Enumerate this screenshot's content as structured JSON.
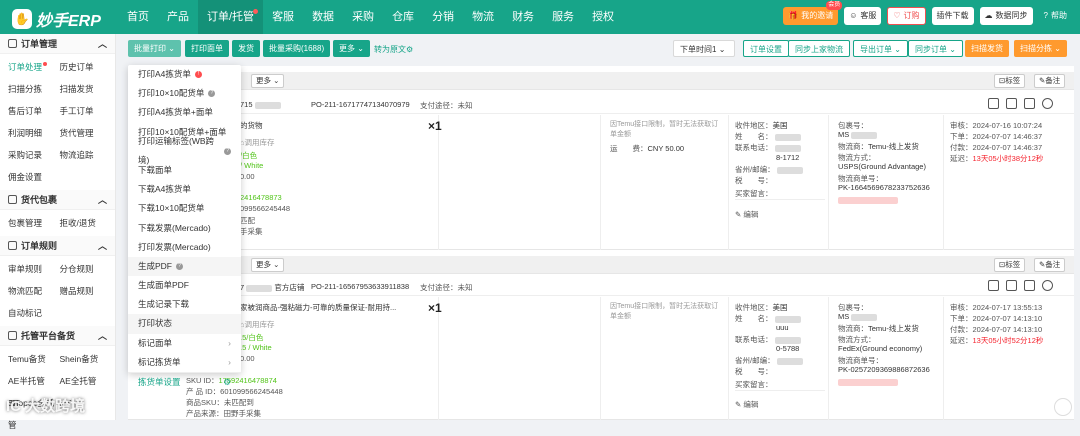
{
  "app": {
    "logo": "妙手ERP"
  },
  "nav": [
    {
      "label": "首页"
    },
    {
      "label": "产品"
    },
    {
      "label": "订单/托管"
    },
    {
      "label": "客服"
    },
    {
      "label": "数据"
    },
    {
      "label": "采购"
    },
    {
      "label": "仓库"
    },
    {
      "label": "分销"
    },
    {
      "label": "物流"
    },
    {
      "label": "财务"
    },
    {
      "label": "服务"
    },
    {
      "label": "授权"
    }
  ],
  "header": {
    "invite": "我的邀请",
    "new_badge": "会员",
    "service": "客服",
    "order_btn": "订购",
    "plugin": "插件下载",
    "data_sync": "数据同步",
    "help": "帮助"
  },
  "sidebar": {
    "sections": [
      {
        "title": "订单管理",
        "items": [
          "订单处理",
          "历史订单",
          "扫描分拣",
          "扫描发货",
          "售后订单",
          "手工订单",
          "利润明细",
          "货代管理",
          "采购记录",
          "物流追踪",
          "佣金设置"
        ]
      },
      {
        "title": "货代包裹",
        "items": [
          "包裹管理",
          "拒收/退货"
        ]
      },
      {
        "title": "订单规则",
        "items": [
          "审单规则",
          "分仓规则",
          "物流匹配",
          "赠品规则",
          "自动标记"
        ]
      },
      {
        "title": "托管平台备货",
        "items": [
          "Temu备货",
          "Shein备货",
          "AE半托管JIT",
          "AE全托管JIT",
          "Shopee全托管"
        ]
      }
    ]
  },
  "toolbar": {
    "batch_print": "批量打印",
    "print_face": "打印面单",
    "ship": "发货",
    "batch_purchase": "批量采购(1688)",
    "more": "更多",
    "transfer": "转为原文",
    "order_time": "下单时间1",
    "order_settings": "订单设置",
    "sync_logistics": "同步上家物流",
    "export": "导出订单",
    "sync_orders": "同步订单",
    "scan_ship": "扫描发货",
    "scan_sort": "扫描分拣"
  },
  "dropdown": {
    "items": [
      "打印A4拣货单",
      "打印10×10配货单",
      "打印A4拣货单+面单",
      "打印10×10配货单+面单",
      "打印运输标签(WB跨境)",
      "下载面单",
      "下载A4拣货单",
      "下载10×10配货单",
      "下载发票(Mercado)",
      "打印发票(Mercado)",
      "生成PDF",
      "生成面单PDF",
      "生成记录下载",
      "打印状态",
      "标记面单",
      "标记拣货单",
      "拣货单设置"
    ]
  },
  "orders": [
    {
      "more": "更多",
      "order_no": "715",
      "po": "PO-211-16717747134070979",
      "pay": "支付途径：未知",
      "tag": "标签",
      "note": "备注",
      "product": "的货物",
      "stock": "调用库存",
      "variant": "/白色",
      "variant2": "/ White",
      "price": "0.00",
      "sku": "2416478873",
      "code": "099566245448",
      "status": "匹配",
      "src": "手采集",
      "qty": "×1",
      "warn": "因Temu接口限制，暂时无法获取订单金额",
      "ship_fee_label": "运　　费：",
      "ship_fee": "CNY 50.00",
      "region_label": "收件地区：",
      "region": "美国",
      "name_label": "姓　　名：",
      "phone_label": "联系电话：",
      "phone": "8-1712",
      "zip_label": "省州/邮编：",
      "tax_label": "税　　号：",
      "buyer_msg": "买家留言：",
      "edit": "编辑",
      "pkg_label": "包裹号：",
      "pkg": "MS",
      "method_label": "物流商：",
      "method": "Temu-线上发货",
      "mode_label": "物流方式：",
      "mode": "USPS(Ground Advantage)",
      "track_label": "物流商单号：",
      "track": "PK-1664569678233752636",
      "t_audit": "审核：",
      "audit": "2024-07-16 10:07:24",
      "t_order": "下单：",
      "order_t": "2024-07-07 14:46:37",
      "t_pay": "付款：",
      "pay_t": "2024-07-07 14:46:37",
      "t_delay": "延迟：",
      "delay": "13天05小时38分12秒"
    },
    {
      "more": "更多",
      "order_no": "7",
      "shop": "官方店铺",
      "po": "PO-211-16567953633911838",
      "pay": "支付途径：未知",
      "tag": "标签",
      "note": "备注",
      "product": "家被润商品-强粘磁力-可靠的质量保证-耐用持...",
      "stock": "调用库存",
      "variant": ".5/白色",
      "variant2": ".5 / White",
      "price": "0.00",
      "sku": "17592416478874",
      "code": "601099566245448",
      "status": "未匹配到",
      "src": "田野手采集",
      "qty": "×1",
      "sku_label": "SKU ID：",
      "code_label": "产 品 ID：",
      "status_label": "商品SKU：",
      "src_label": "产品来源：",
      "warn": "因Temu接口限制，暂时无法获取订单金额",
      "region_label": "收件地区：",
      "region": "美国",
      "name_label": "姓　　名：",
      "name": "uuu",
      "phone_label": "联系电话：",
      "phone": "0-5788",
      "zip_label": "省州/邮编：",
      "tax_label": "税　　号：",
      "buyer_msg": "买家留言：",
      "edit": "编辑",
      "pkg_label": "包裹号：",
      "pkg": "MS",
      "method_label": "物流商：",
      "method": "Temu-线上发货",
      "mode_label": "物流方式：",
      "mode": "FedEx(Ground economy)",
      "track_label": "物流商单号：",
      "track": "PK-0257209369886872636",
      "t_audit": "审核：",
      "audit": "2024-07-17 13:55:13",
      "t_order": "下单：",
      "order_t": "2024-07-07 14:13:10",
      "t_pay": "付款：",
      "pay_t": "2024-07-07 14:13:10",
      "t_delay": "延迟：",
      "delay": "13天05小时52分12秒"
    }
  ],
  "watermark": "IC 大数跨境"
}
